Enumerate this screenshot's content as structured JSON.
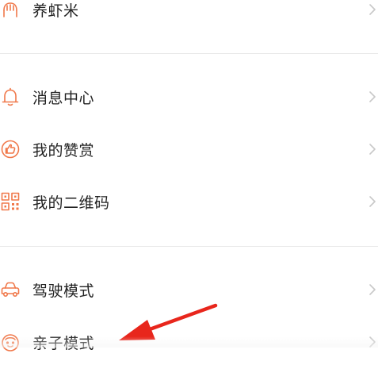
{
  "menu": {
    "items": [
      {
        "label": "养虾米",
        "icon": "shrimp-icon"
      },
      {
        "label": "消息中心",
        "icon": "bell-icon"
      },
      {
        "label": "我的赞赏",
        "icon": "thumbs-up-icon"
      },
      {
        "label": "我的二维码",
        "icon": "qr-code-icon"
      },
      {
        "label": "驾驶模式",
        "icon": "car-icon"
      },
      {
        "label": "亲子模式",
        "icon": "child-face-icon"
      }
    ]
  },
  "colors": {
    "accent": "#f0784a",
    "text": "#222222",
    "chevron": "#c8c8c8",
    "divider": "#e8e8e8",
    "arrow": "#e8261c"
  }
}
